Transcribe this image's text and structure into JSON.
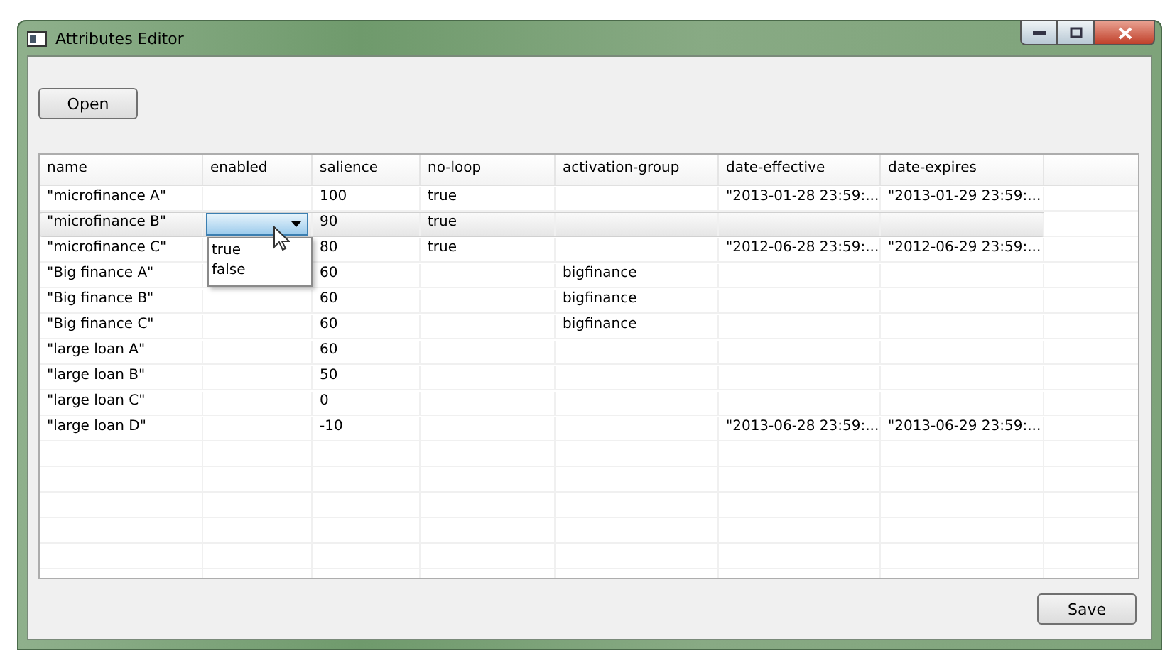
{
  "window": {
    "title": "Attributes Editor"
  },
  "open_button": "Open",
  "table": {
    "columns": [
      "name",
      "enabled",
      "salience",
      "no-loop",
      "activation-group",
      "date-effective",
      "date-expires"
    ],
    "rows": [
      {
        "selected": false,
        "cells": [
          "\"microfinance A\"",
          null,
          "100",
          "true",
          null,
          "\"2013-01-28 23:59:...",
          "\"2013-01-29 23:59:..."
        ]
      },
      {
        "selected": true,
        "cells": [
          "\"microfinance B\"",
          {
            "kind": "dropdown",
            "expanded": true
          },
          "90",
          "true",
          null,
          null,
          null
        ]
      },
      {
        "selected": false,
        "cells": [
          "\"microfinance C\"",
          null,
          "80",
          "true",
          null,
          "\"2012-06-28 23:59:...",
          "\"2012-06-29 23:59:..."
        ]
      },
      {
        "selected": false,
        "cells": [
          "\"Big finance A\"",
          null,
          "60",
          null,
          "bigfinance",
          null,
          null
        ]
      },
      {
        "selected": false,
        "cells": [
          "\"Big finance B\"",
          null,
          "60",
          null,
          "bigfinance",
          null,
          null
        ]
      },
      {
        "selected": false,
        "cells": [
          "\"Big finance C\"",
          null,
          "60",
          null,
          "bigfinance",
          null,
          null
        ]
      },
      {
        "selected": false,
        "cells": [
          "\"large loan A\"",
          null,
          "60",
          null,
          null,
          null,
          null
        ]
      },
      {
        "selected": false,
        "cells": [
          "\"large loan B\"",
          null,
          "50",
          null,
          null,
          null,
          null
        ]
      },
      {
        "selected": false,
        "cells": [
          "\"large loan C\"",
          null,
          "0",
          null,
          null,
          null,
          null
        ]
      },
      {
        "selected": false,
        "cells": [
          "\"large loan D\"",
          null,
          "-10",
          null,
          null,
          "\"2013-06-28 23:59:...",
          "\"2013-06-29 23:59:..."
        ]
      }
    ]
  },
  "dropdown_list": {
    "options": [
      {
        "label": "true",
        "selected": false
      },
      {
        "label": "false",
        "selected": false
      }
    ]
  },
  "save_button": "Save"
}
